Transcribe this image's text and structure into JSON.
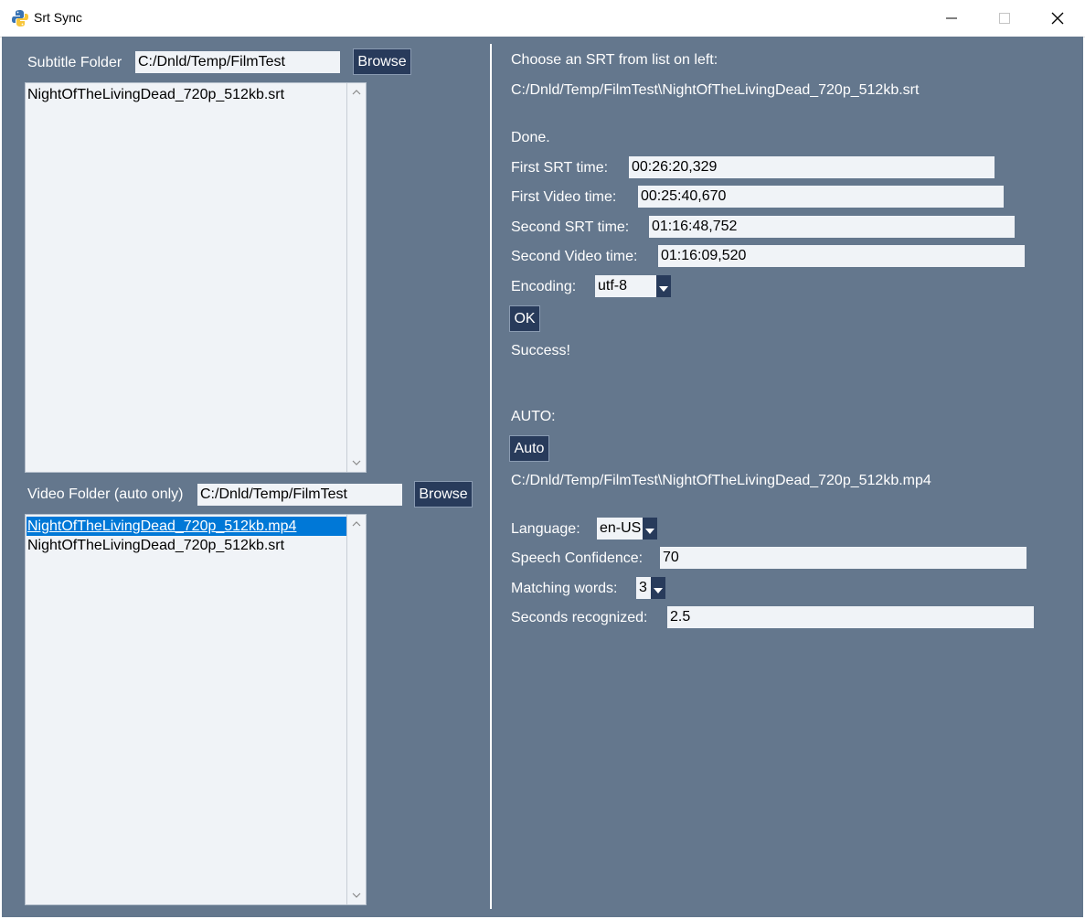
{
  "window": {
    "title": "Srt Sync",
    "minimize_glyph": "—",
    "maximize_glyph": "☐",
    "close_glyph": "✕"
  },
  "colors": {
    "background": "#64778d",
    "button": "#283b5b",
    "input": "#f0f3f7",
    "selection": "#0078d7"
  },
  "left": {
    "subtitle_folder": {
      "label": "Subtitle Folder",
      "value": "C:/Dnld/Temp/FilmTest",
      "browse_label": "Browse"
    },
    "subtitle_files": [
      "NightOfTheLivingDead_720p_512kb.srt"
    ],
    "video_folder": {
      "label": "Video Folder (auto only)",
      "value": "C:/Dnld/Temp/FilmTest",
      "browse_label": "Browse"
    },
    "video_files": [
      {
        "name": "NightOfTheLivingDead_720p_512kb.mp4",
        "selected": true
      },
      {
        "name": "NightOfTheLivingDead_720p_512kb.srt",
        "selected": false
      }
    ]
  },
  "right": {
    "instructions": "Choose an SRT from list on left:",
    "selected_srt_path": "C:/Dnld/Temp/FilmTest\\NightOfTheLivingDead_720p_512kb.srt",
    "status": "Done.",
    "first_srt_time": {
      "label": "First SRT time:",
      "value": "00:26:20,329"
    },
    "first_video_time": {
      "label": "First Video time:",
      "value": "00:25:40,670"
    },
    "second_srt_time": {
      "label": "Second SRT time:",
      "value": "01:16:48,752"
    },
    "second_video_time": {
      "label": "Second Video time:",
      "value": "01:16:09,520"
    },
    "encoding": {
      "label": "Encoding:",
      "value": "utf-8"
    },
    "ok_label": "OK",
    "result": "Success!",
    "auto_heading": "AUTO:",
    "auto_label": "Auto",
    "video_path": "C:/Dnld/Temp/FilmTest\\NightOfTheLivingDead_720p_512kb.mp4",
    "language": {
      "label": "Language:",
      "value": "en-US"
    },
    "speech_confidence": {
      "label": "Speech Confidence:",
      "value": "70"
    },
    "matching_words": {
      "label": "Matching words:",
      "value": "3"
    },
    "seconds_recognized": {
      "label": "Seconds recognized:",
      "value": "2.5"
    }
  }
}
